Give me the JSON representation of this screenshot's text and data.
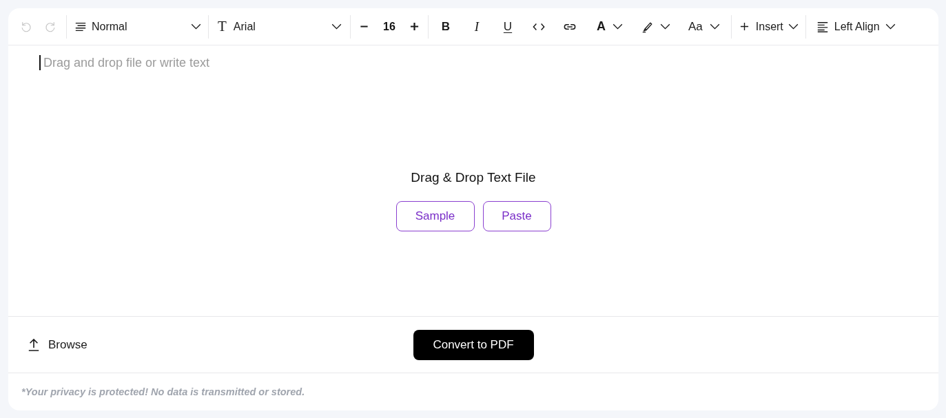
{
  "toolbar": {
    "history": [
      {
        "kind": "undo",
        "disabled": true
      },
      {
        "kind": "redo",
        "disabled": true
      }
    ],
    "paragraph_style": {
      "value": "Normal"
    },
    "font_family": {
      "icon": "T",
      "value": "Arial"
    },
    "font_size": {
      "value": "16"
    },
    "format_buttons": [
      {
        "kind": "bold",
        "label": "B"
      },
      {
        "kind": "italic",
        "label": "I"
      },
      {
        "kind": "underline",
        "label": "U"
      },
      {
        "kind": "code"
      },
      {
        "kind": "link"
      }
    ],
    "style_menus": [
      {
        "kind": "text_color",
        "label": "A"
      },
      {
        "kind": "highlight"
      },
      {
        "kind": "case",
        "label": "Aa"
      }
    ],
    "insert": {
      "label": "Insert"
    },
    "align": {
      "label": "Left Align"
    }
  },
  "editor": {
    "placeholder": "Drag and drop file or write text"
  },
  "dropzone": {
    "title": "Drag & Drop Text File",
    "buttons": [
      "Sample",
      "Paste"
    ]
  },
  "footer": {
    "browse": "Browse",
    "convert": "Convert to PDF"
  },
  "privacy_note": "*Your privacy is protected! No data is transmitted or stored."
}
